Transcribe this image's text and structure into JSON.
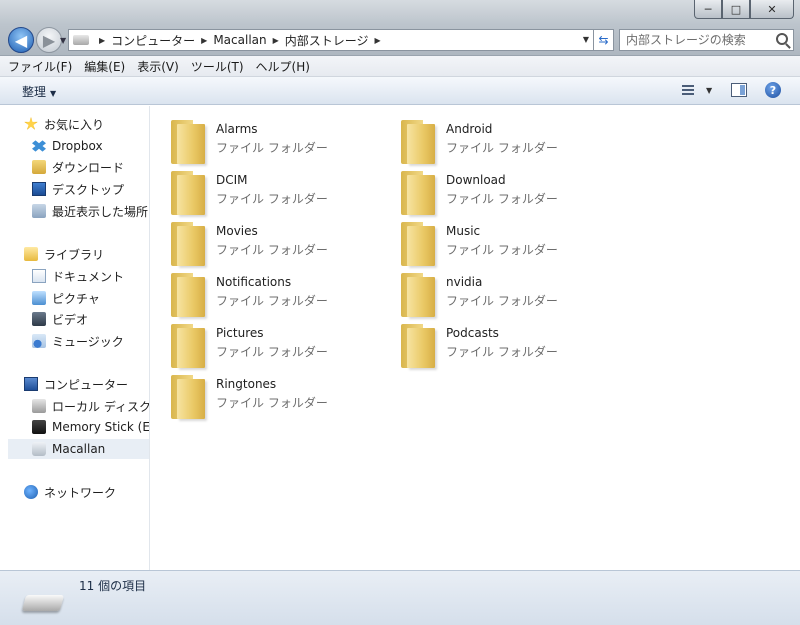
{
  "window": {
    "minimize": "─",
    "maximize": "□",
    "close": "✕"
  },
  "nav": {
    "back": "◀",
    "forward": "▶"
  },
  "address": {
    "breadcrumbs": [
      "コンピューター",
      "Macallan",
      "内部ストレージ"
    ]
  },
  "search": {
    "placeholder": "内部ストレージの検索"
  },
  "menu": {
    "items": [
      "ファイル(F)",
      "編集(E)",
      "表示(V)",
      "ツール(T)",
      "ヘルプ(H)"
    ]
  },
  "toolbar": {
    "organize": "整理",
    "help": "?"
  },
  "sidebar": {
    "favorites": "お気に入り",
    "favorite_items": [
      "Dropbox",
      "ダウンロード",
      "デスクトップ",
      "最近表示した場所"
    ],
    "libraries": "ライブラリ",
    "library_items": [
      "ドキュメント",
      "ピクチャ",
      "ビデオ",
      "ミュージック"
    ],
    "computer": "コンピューター",
    "computer_items": [
      "ローカル ディスク (",
      "Memory Stick (E:)",
      "Macallan"
    ],
    "network": "ネットワーク"
  },
  "folders": [
    {
      "name": "Alarms",
      "type": "ファイル フォルダー"
    },
    {
      "name": "Android",
      "type": "ファイル フォルダー"
    },
    {
      "name": "DCIM",
      "type": "ファイル フォルダー"
    },
    {
      "name": "Download",
      "type": "ファイル フォルダー"
    },
    {
      "name": "Movies",
      "type": "ファイル フォルダー"
    },
    {
      "name": "Music",
      "type": "ファイル フォルダー"
    },
    {
      "name": "Notifications",
      "type": "ファイル フォルダー"
    },
    {
      "name": "nvidia",
      "type": "ファイル フォルダー"
    },
    {
      "name": "Pictures",
      "type": "ファイル フォルダー"
    },
    {
      "name": "Podcasts",
      "type": "ファイル フォルダー"
    },
    {
      "name": "Ringtones",
      "type": "ファイル フォルダー"
    }
  ],
  "status": {
    "item_count": "11 個の項目"
  }
}
